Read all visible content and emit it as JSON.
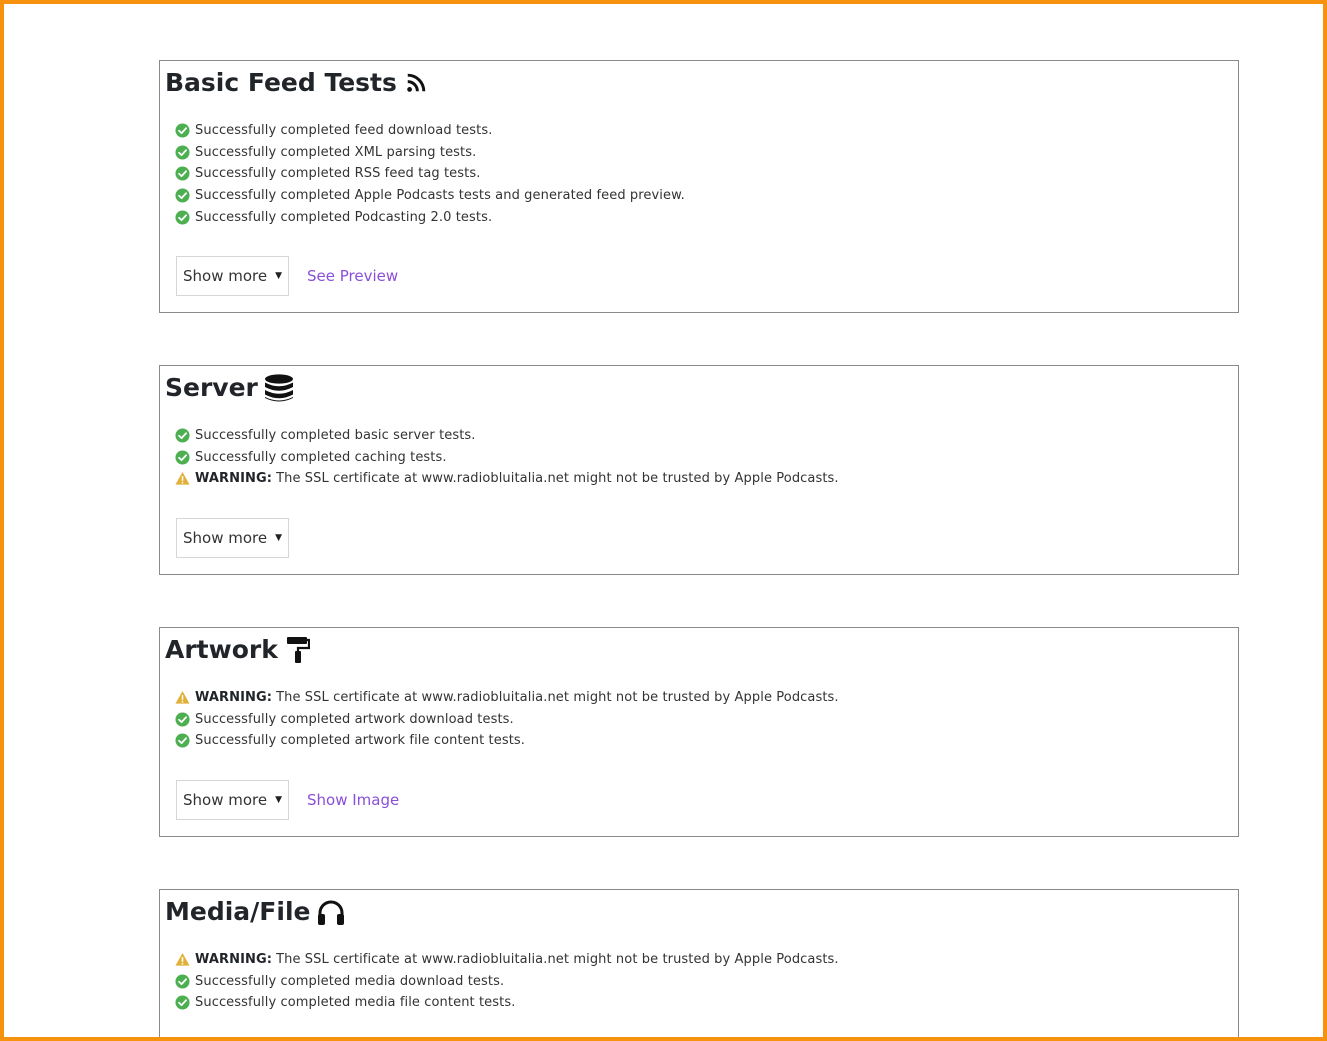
{
  "cards": [
    {
      "title": "Basic Feed Tests",
      "icon": "rss-icon",
      "results": [
        {
          "status": "success",
          "text": "Successfully completed feed download tests."
        },
        {
          "status": "success",
          "text": "Successfully completed XML parsing tests."
        },
        {
          "status": "success",
          "text": "Successfully completed RSS feed tag tests."
        },
        {
          "status": "success",
          "text": "Successfully completed Apple Podcasts tests and generated feed preview."
        },
        {
          "status": "success",
          "text": "Successfully completed Podcasting 2.0 tests."
        }
      ],
      "show_more_label": "Show more",
      "link_label": "See Preview"
    },
    {
      "title": "Server",
      "icon": "database-icon",
      "results": [
        {
          "status": "success",
          "text": "Successfully completed basic server tests."
        },
        {
          "status": "success",
          "text": "Successfully completed caching tests."
        },
        {
          "status": "warning",
          "prefix": "WARNING:",
          "text": "The SSL certificate at www.radiobluitalia.net might not be trusted by Apple Podcasts."
        }
      ],
      "show_more_label": "Show more"
    },
    {
      "title": "Artwork",
      "icon": "paint-roller-icon",
      "results": [
        {
          "status": "warning",
          "prefix": "WARNING:",
          "text": "The SSL certificate at www.radiobluitalia.net might not be trusted by Apple Podcasts."
        },
        {
          "status": "success",
          "text": "Successfully completed artwork download tests."
        },
        {
          "status": "success",
          "text": "Successfully completed artwork file content tests."
        }
      ],
      "show_more_label": "Show more",
      "link_label": "Show Image"
    },
    {
      "title": "Media/File",
      "icon": "headphones-icon",
      "results": [
        {
          "status": "warning",
          "prefix": "WARNING:",
          "text": "The SSL certificate at www.radiobluitalia.net might not be trusted by Apple Podcasts."
        },
        {
          "status": "success",
          "text": "Successfully completed media download tests."
        },
        {
          "status": "success",
          "text": "Successfully completed media file content tests."
        }
      ]
    }
  ],
  "colors": {
    "frame": "#f7920f",
    "success": "#4caf50",
    "warning": "#e0b03a",
    "link": "#8a4fd9"
  }
}
